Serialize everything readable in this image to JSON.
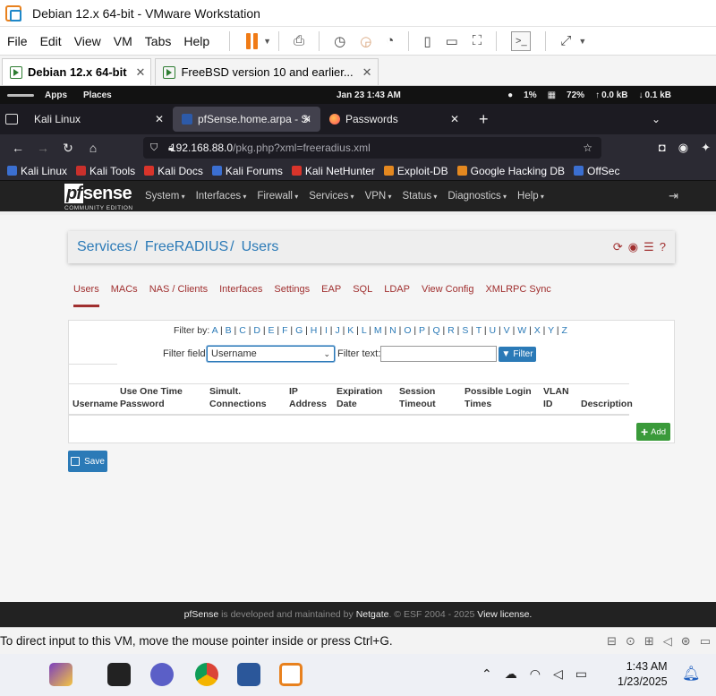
{
  "vmware": {
    "title": "Debian 12.x 64-bit - VMware Workstation",
    "menu": [
      "File",
      "Edit",
      "View",
      "VM",
      "Tabs",
      "Help"
    ],
    "tabs": [
      {
        "label": "Debian 12.x 64-bit",
        "active": true
      },
      {
        "label": "FreeBSD version 10 and earlier...",
        "active": false
      }
    ],
    "status_text": "To direct input to this VM, move the mouse pointer inside or press Ctrl+G."
  },
  "kali_bar": {
    "apps": "Apps",
    "places": "Places",
    "clock": "Jan 23   1:43 AM",
    "cpu": "1%",
    "memory": "72%",
    "net_up": "0.0 kB",
    "net_down": "0.1 kB"
  },
  "firefox": {
    "tabs": [
      {
        "label": "Kali Linux",
        "active": false
      },
      {
        "label": "pfSense.home.arpa - Serv",
        "active": true
      },
      {
        "label": "Passwords",
        "active": false
      }
    ],
    "url_host": "192.168.88.0",
    "url_path": "/pkg.php?xml=freeradius.xml",
    "bookmarks": [
      {
        "label": "Kali Linux",
        "color": "#3b6fd1"
      },
      {
        "label": "Kali Tools",
        "color": "#c9302c"
      },
      {
        "label": "Kali Docs",
        "color": "#d9342b"
      },
      {
        "label": "Kali Forums",
        "color": "#3b6fd1"
      },
      {
        "label": "Kali NetHunter",
        "color": "#d9342b"
      },
      {
        "label": "Exploit-DB",
        "color": "#e48820"
      },
      {
        "label": "Google Hacking DB",
        "color": "#e48820"
      },
      {
        "label": "OffSec",
        "color": "#3b6fd1"
      }
    ]
  },
  "pfsense": {
    "logo_pf": "pf",
    "logo_sense": "sense",
    "logo_edition": "COMMUNITY EDITION",
    "menu": [
      "System",
      "Interfaces",
      "Firewall",
      "Services",
      "VPN",
      "Status",
      "Diagnostics",
      "Help"
    ],
    "breadcrumb": [
      "Services",
      "FreeRADIUS",
      "Users"
    ],
    "subtabs": [
      "Users",
      "MACs",
      "NAS / Clients",
      "Interfaces",
      "Settings",
      "EAP",
      "SQL",
      "LDAP",
      "View Config",
      "XMLRPC Sync"
    ],
    "filter_by_label": "Filter by:",
    "letters": [
      "A",
      "B",
      "C",
      "D",
      "E",
      "F",
      "G",
      "H",
      "I",
      "J",
      "K",
      "L",
      "M",
      "N",
      "O",
      "P",
      "Q",
      "R",
      "S",
      "T",
      "U",
      "V",
      "W",
      "X",
      "Y",
      "Z"
    ],
    "filter_field_label": "Filter field:",
    "filter_field_value": "Username",
    "filter_text_label": "Filter text:",
    "filter_button": "Filter",
    "columns": [
      {
        "line1": "",
        "line2": "Username"
      },
      {
        "line1": "Use One Time",
        "line2": "Password"
      },
      {
        "line1": "Simult.",
        "line2": "Connections"
      },
      {
        "line1": "IP",
        "line2": "Address"
      },
      {
        "line1": "Expiration",
        "line2": "Date"
      },
      {
        "line1": "Session",
        "line2": "Timeout"
      },
      {
        "line1": "Possible Login",
        "line2": "Times"
      },
      {
        "line1": "VLAN",
        "line2": "ID"
      },
      {
        "line1": "",
        "line2": "Description"
      }
    ],
    "add_button": "Add",
    "save_button": "Save",
    "footer": {
      "brand": "pfSense",
      "middle": " is developed and maintained by ",
      "company": "Netgate",
      "copyright": ". © ESF 2004 - 2025 ",
      "license": "View license."
    }
  },
  "taskbar": {
    "time": "1:43 AM",
    "date": "1/23/2025"
  }
}
